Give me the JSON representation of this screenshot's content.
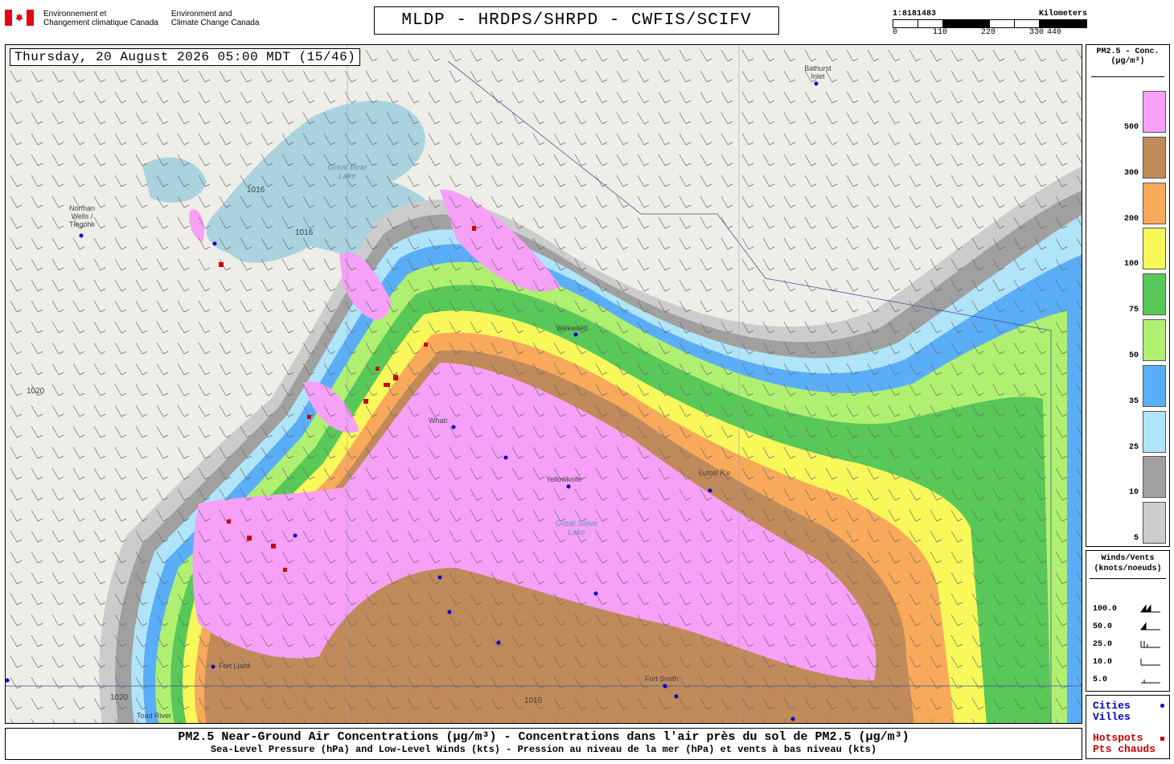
{
  "header": {
    "gov_fr": [
      "Environnement et",
      "Changement climatique Canada"
    ],
    "gov_en": [
      "Environment and",
      "Climate Change Canada"
    ],
    "title": "MLDP - HRDPS/SHRPD - CWFIS/SCIFV",
    "scale_ratio": "1:8181483",
    "scale_unit": "Kilometers",
    "scale_ticks": [
      "0",
      "110",
      "220",
      "330",
      "440"
    ]
  },
  "map": {
    "timestamp": "Thursday, 20 August 2026 05:00 MDT (15/46)",
    "places": [
      {
        "name": "Bathurst Inlet"
      },
      {
        "name": "Norman Wells / Tłegóhłı"
      },
      {
        "name": "Wekweètì"
      },
      {
        "name": "Whatì"
      },
      {
        "name": "Yellowknife"
      },
      {
        "name": "Łutsel K'e"
      },
      {
        "name": "Fort Smith"
      },
      {
        "name": "Fort Liard"
      },
      {
        "name": "Toad River"
      }
    ],
    "lakes": [
      {
        "name": "Great Bear Lake"
      },
      {
        "name": "Great Slave Lake"
      }
    ],
    "isobars": [
      "1016",
      "1020"
    ]
  },
  "legend": {
    "conc_title": [
      "PM2.5 - Conc.",
      "(µg/m³)"
    ],
    "conc_levels": [
      {
        "label": "500",
        "color": "#f7a0f7"
      },
      {
        "label": "300",
        "color": "#c08a5a"
      },
      {
        "label": "200",
        "color": "#f8a95a"
      },
      {
        "label": "100",
        "color": "#f8f85a"
      },
      {
        "label": "75",
        "color": "#58c858"
      },
      {
        "label": "50",
        "color": "#b0f070"
      },
      {
        "label": "35",
        "color": "#5aaef8"
      },
      {
        "label": "25",
        "color": "#b0e4f8"
      },
      {
        "label": "10",
        "color": "#a0a0a0"
      },
      {
        "label": "5",
        "color": "#cccccc"
      }
    ],
    "wind_title": [
      "Winds/Vents",
      "(knots/noeuds)"
    ],
    "wind_levels": [
      "100.0",
      "50.0",
      "25.0",
      "10.0",
      "5.0"
    ],
    "cities": [
      "Cities",
      "Villes"
    ],
    "hotspots": [
      "Hotspots",
      "Pts chauds"
    ],
    "city_color": "#0000cc",
    "hotspot_color": "#cc0000"
  },
  "footer": {
    "line1": "PM2.5 Near-Ground Air Concentrations (µg/m³) - Concentrations dans l'air près du sol de PM2.5 (µg/m³)",
    "line2": "Sea-Level Pressure (hPa) and Low-Level Winds (kts) - Pression au niveau de la mer (hPa) et vents à bas niveau (kts)"
  }
}
